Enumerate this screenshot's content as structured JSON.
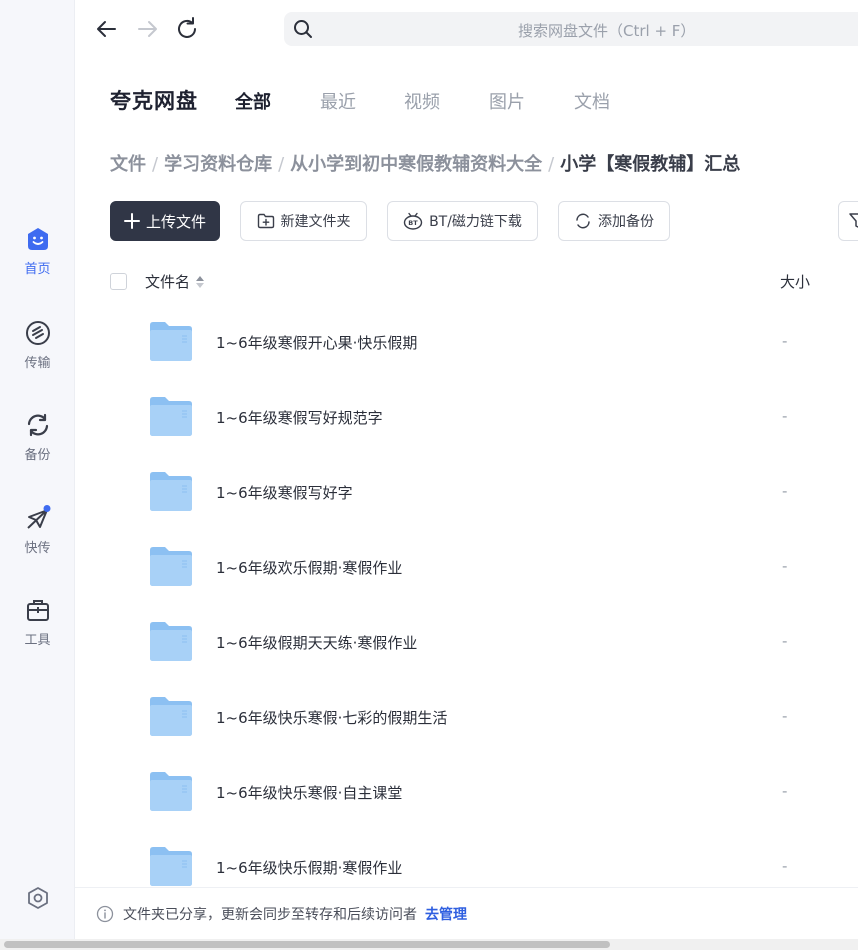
{
  "sidebar": {
    "items": [
      {
        "label": "首页",
        "icon": "home-icon",
        "active": true
      },
      {
        "label": "传输",
        "icon": "transfer-icon"
      },
      {
        "label": "备份",
        "icon": "backup-icon"
      },
      {
        "label": "快传",
        "icon": "quick-send-icon",
        "badge": true
      },
      {
        "label": "工具",
        "icon": "toolbox-icon"
      }
    ],
    "settings_icon": "settings-icon"
  },
  "topbar": {
    "search_placeholder": "搜索网盘文件（Ctrl + F）"
  },
  "header": {
    "brand": "夸克网盘",
    "tabs": [
      {
        "label": "全部",
        "active": true
      },
      {
        "label": "最近"
      },
      {
        "label": "视频"
      },
      {
        "label": "图片"
      },
      {
        "label": "文档"
      }
    ]
  },
  "breadcrumb": [
    "文件",
    "学习资料仓库",
    "从小学到初中寒假教辅资料大全",
    "小学【寒假教辅】汇总"
  ],
  "toolbar": {
    "upload": "上传文件",
    "new_folder": "新建文件夹",
    "bt_download": "BT/磁力链下载",
    "add_backup": "添加备份"
  },
  "table": {
    "col_name": "文件名",
    "col_size": "大小",
    "rows": [
      {
        "name": "1~6年级寒假开心果·快乐假期",
        "size": "-"
      },
      {
        "name": "1~6年级寒假写好规范字",
        "size": "-"
      },
      {
        "name": "1~6年级寒假写好字",
        "size": "-"
      },
      {
        "name": "1~6年级欢乐假期·寒假作业",
        "size": "-"
      },
      {
        "name": "1~6年级假期天天练·寒假作业",
        "size": "-"
      },
      {
        "name": "1~6年级快乐寒假·七彩的假期生活",
        "size": "-"
      },
      {
        "name": "1~6年级快乐寒假·自主课堂",
        "size": "-"
      },
      {
        "name": "1~6年级快乐假期·寒假作业",
        "size": "-"
      }
    ]
  },
  "notice": {
    "text": "文件夹已分享，更新会同步至转存和后续访问者",
    "link": "去管理"
  },
  "colors": {
    "accent": "#3e6bf0",
    "primary_button": "#303646",
    "folder": "#7fb5ef"
  }
}
